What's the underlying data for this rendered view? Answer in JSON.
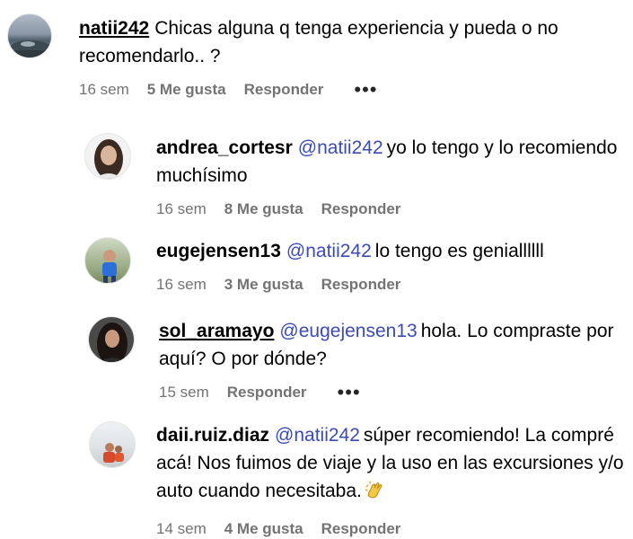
{
  "comments": [
    {
      "username": "natii242",
      "mention": "",
      "text": "Chicas alguna q tenga experiencia y pueda o no recomendarlo.. ?",
      "time": "16 sem",
      "likes": "5 Me gusta",
      "reply": "Responder",
      "more": "•••"
    },
    {
      "username": "andrea_cortesr",
      "mention": "@natii242",
      "text": "yo lo tengo y lo recomiendo muchísimo",
      "time": "16 sem",
      "likes": "8 Me gusta",
      "reply": "Responder"
    },
    {
      "username": "eugejensen13",
      "mention": "@natii242",
      "text": "lo tengo es geniallllll",
      "time": "16 sem",
      "likes": "3 Me gusta",
      "reply": "Responder"
    },
    {
      "username": "sol_aramayo",
      "mention": "@eugejensen13",
      "text": "hola. Lo compraste por aquí? O por dónde?",
      "time": "15 sem",
      "reply": "Responder",
      "more": "•••"
    },
    {
      "username": "daii.ruiz.diaz",
      "mention": "@natii242",
      "text": "súper recomiendo! La compré acá! Nos fuimos de viaje y la uso en las excursiones y/o auto cuando necesitaba.",
      "time": "14 sem",
      "likes": "4 Me gusta",
      "reply": "Responder",
      "emoji": "clapping-hands-icon"
    }
  ]
}
